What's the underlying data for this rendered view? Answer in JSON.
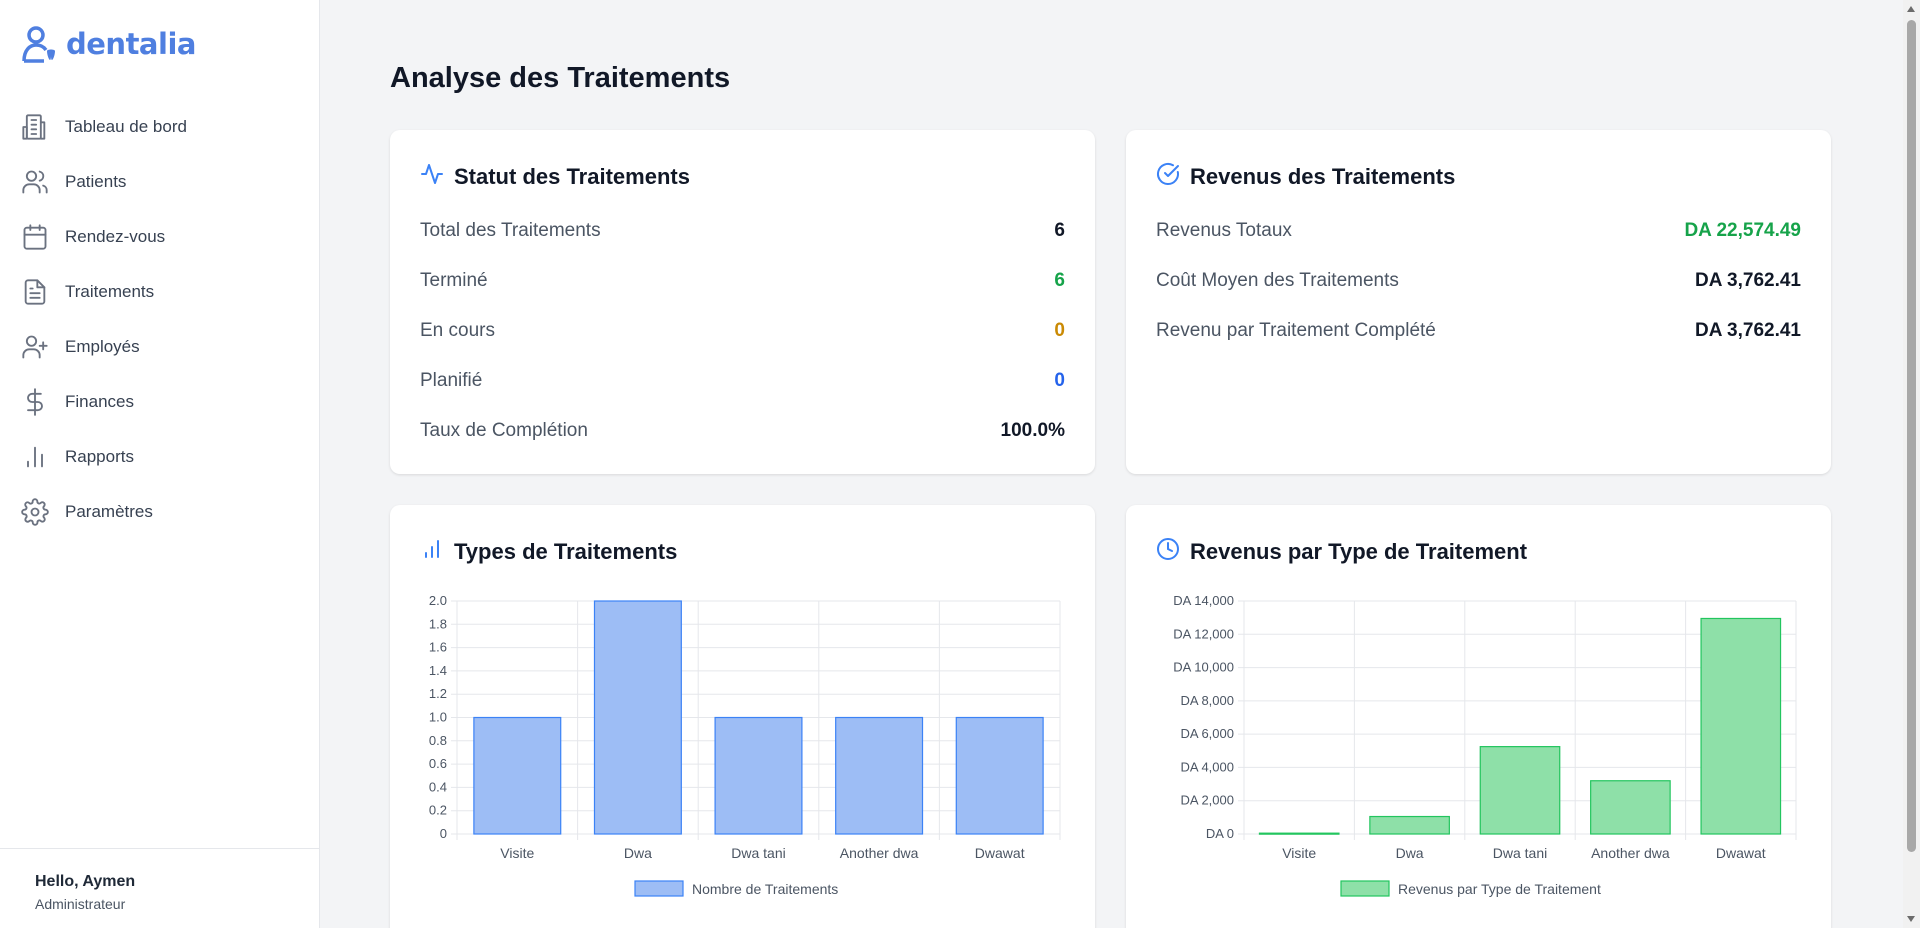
{
  "app": {
    "logo_text": "dentalia"
  },
  "sidebar": {
    "items": [
      {
        "label": "Tableau de bord",
        "icon": "building-icon"
      },
      {
        "label": "Patients",
        "icon": "users-icon"
      },
      {
        "label": "Rendez-vous",
        "icon": "calendar-icon"
      },
      {
        "label": "Traitements",
        "icon": "file-text-icon"
      },
      {
        "label": "Employés",
        "icon": "user-plus-icon"
      },
      {
        "label": "Finances",
        "icon": "dollar-icon"
      },
      {
        "label": "Rapports",
        "icon": "bar-chart-icon"
      },
      {
        "label": "Paramètres",
        "icon": "gear-icon"
      }
    ],
    "user_greeting": "Hello, Aymen",
    "user_role": "Administrateur"
  },
  "main": {
    "title": "Analyse des Traitements",
    "status_card": {
      "title": "Statut des Traitements",
      "icon": "activity-icon",
      "rows": [
        {
          "label": "Total des Traitements",
          "value": "6",
          "color": "#111827"
        },
        {
          "label": "Terminé",
          "value": "6",
          "color": "#16a34a"
        },
        {
          "label": "En cours",
          "value": "0",
          "color": "#ca8a04"
        },
        {
          "label": "Planifié",
          "value": "0",
          "color": "#2563eb"
        },
        {
          "label": "Taux de Complétion",
          "value": "100.0%",
          "color": "#111827"
        }
      ]
    },
    "revenue_card": {
      "title": "Revenus des Traitements",
      "icon": "check-circle-icon",
      "rows": [
        {
          "label": "Revenus Totaux",
          "value": "DA 22,574.49",
          "color": "#16a34a"
        },
        {
          "label": "Coût Moyen des Traitements",
          "value": "DA 3,762.41",
          "color": "#111827"
        },
        {
          "label": "Revenu par Traitement Complété",
          "value": "DA 3,762.41",
          "color": "#111827"
        }
      ]
    },
    "types_card": {
      "title": "Types de Traitements",
      "icon": "bar-chart-icon"
    },
    "rev_type_card": {
      "title": "Revenus par Type de Traitement",
      "icon": "clock-icon"
    }
  },
  "colors": {
    "accent": "#4f7fe0",
    "blue_fill": "#9dbdf5",
    "blue_stroke": "#3b82f6",
    "green_fill": "#8ee0a8",
    "green_stroke": "#22c55e"
  },
  "chart_data": [
    {
      "type": "bar",
      "categories": [
        "Visite",
        "Dwa",
        "Dwa tani",
        "Another dwa",
        "Dwawat"
      ],
      "series": [
        {
          "name": "Nombre de Traitements",
          "values": [
            1,
            2,
            1,
            1,
            1
          ]
        }
      ],
      "ylim": [
        0,
        2
      ],
      "yticks": [
        0,
        0.2,
        0.4,
        0.6,
        0.8,
        1.0,
        1.2,
        1.4,
        1.6,
        1.8,
        2.0
      ],
      "ytick_labels": [
        "0",
        "0.2",
        "0.4",
        "0.6",
        "0.8",
        "1.0",
        "1.2",
        "1.4",
        "1.6",
        "1.8",
        "2.0"
      ],
      "grid": true,
      "legend": "bottom"
    },
    {
      "type": "bar",
      "categories": [
        "Visite",
        "Dwa",
        "Dwa tani",
        "Another dwa",
        "Dwawat"
      ],
      "series": [
        {
          "name": "Revenus par Type de Traitement",
          "values": [
            50,
            1050,
            5250,
            3200,
            12950
          ]
        }
      ],
      "ylim": [
        0,
        14000
      ],
      "yticks": [
        0,
        2000,
        4000,
        6000,
        8000,
        10000,
        12000,
        14000
      ],
      "ytick_labels": [
        "DA 0",
        "DA 2,000",
        "DA 4,000",
        "DA 6,000",
        "DA 8,000",
        "DA 10,000",
        "DA 12,000",
        "DA 14,000"
      ],
      "grid": true,
      "legend": "bottom"
    }
  ]
}
